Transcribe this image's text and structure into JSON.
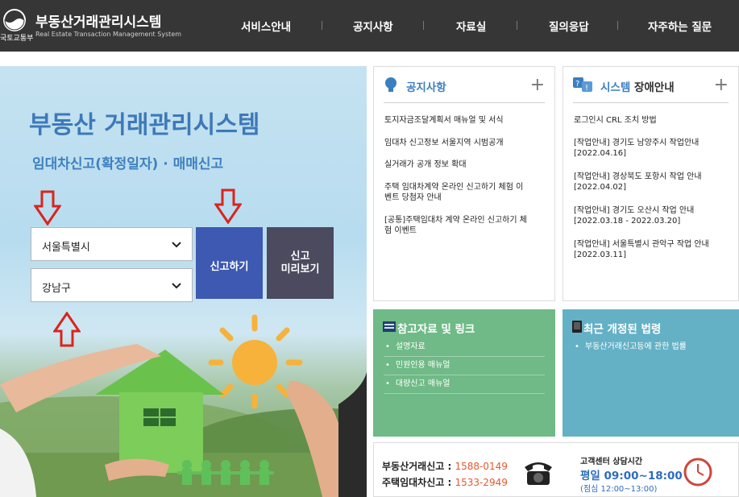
{
  "header": {
    "ministry": "국토교통부",
    "title": "부동산거래관리시스템",
    "subtitle": "Real Estate Transaction Management System",
    "nav": [
      "서비스안내",
      "공지사항",
      "자료실",
      "질의응답",
      "자주하는 질문"
    ]
  },
  "hero": {
    "title": "부동산 거래관리시스템",
    "subtitle": "임대차신고(확정일자) · 매매신고",
    "city_select": "서울특별시",
    "district_select": "강남구",
    "report_button": "신고하기",
    "preview_button_line1": "신고",
    "preview_button_line2": "미리보기"
  },
  "notice": {
    "title": "공지사항",
    "plus": "+",
    "items": [
      "토지자금조달계획서 매뉴얼 및 서식",
      "임대차 신고정보 서울지역 시범공개",
      "실거래가 공개 정보 확대",
      "주택 임대차계약 온라인 신고하기 체험 이",
      "벤트 당첨자 안내",
      "[공통]주택임대차 계약 온라인 신고하기 체",
      "험 이벤트"
    ]
  },
  "system": {
    "title_accent": "시스템",
    "title_rest": "장애안내",
    "plus": "+",
    "items": [
      "로그인시 CRL 조치 방법",
      "[작업안내] 경기도 남양주시 작업안내",
      "[2022.04.16]",
      "[작업안내] 경상북도 포항시 작업 안내",
      "[2022.04.02]",
      "[작업안내] 경기도 오산시 작업 안내",
      "[2022.03.18 - 2022.03.20]",
      "[작업안내] 서울특별시 관악구 작업 안내",
      "[2022.03.11]"
    ]
  },
  "references": {
    "title": "참고자료 및 링크",
    "items": [
      "설명자료",
      "민원인용 매뉴얼",
      "대량신고 매뉴얼"
    ]
  },
  "laws": {
    "title": "최근 개정된 법령",
    "items": [
      "부동산거래신고등에 관한 법률"
    ]
  },
  "contact": {
    "line1_label": "부동산거래신고 : ",
    "line1_number": "1588-0149",
    "line2_label": "주택임대차신고 : ",
    "line2_number": "1533-2949",
    "hours_title": "고객센터 상담시간",
    "hours": "평일 09:00~18:00",
    "lunch": "(점심 12:00~13:00)"
  },
  "colors": {
    "header_bg": "#363636",
    "report_button": "#3d59b1",
    "preview_button": "#4b4a5e",
    "accent_blue": "#3a7fc1",
    "green_box": "#6fba86",
    "teal_box": "#64b1c6",
    "phone_orange": "#e8572e",
    "arrow_red": "#d9251c"
  }
}
